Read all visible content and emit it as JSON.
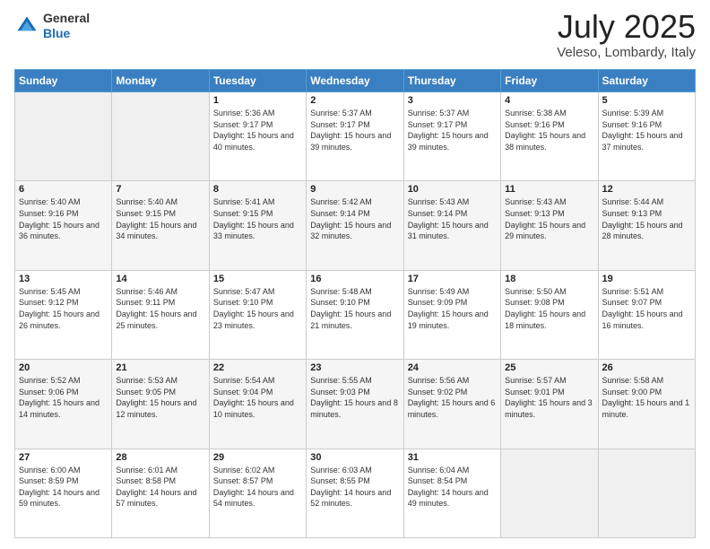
{
  "header": {
    "logo_general": "General",
    "logo_blue": "Blue",
    "month_title": "July 2025",
    "location": "Veleso, Lombardy, Italy"
  },
  "weekdays": [
    "Sunday",
    "Monday",
    "Tuesday",
    "Wednesday",
    "Thursday",
    "Friday",
    "Saturday"
  ],
  "weeks": [
    [
      {
        "day": "",
        "sunrise": "",
        "sunset": "",
        "daylight": ""
      },
      {
        "day": "",
        "sunrise": "",
        "sunset": "",
        "daylight": ""
      },
      {
        "day": "1",
        "sunrise": "Sunrise: 5:36 AM",
        "sunset": "Sunset: 9:17 PM",
        "daylight": "Daylight: 15 hours and 40 minutes."
      },
      {
        "day": "2",
        "sunrise": "Sunrise: 5:37 AM",
        "sunset": "Sunset: 9:17 PM",
        "daylight": "Daylight: 15 hours and 39 minutes."
      },
      {
        "day": "3",
        "sunrise": "Sunrise: 5:37 AM",
        "sunset": "Sunset: 9:17 PM",
        "daylight": "Daylight: 15 hours and 39 minutes."
      },
      {
        "day": "4",
        "sunrise": "Sunrise: 5:38 AM",
        "sunset": "Sunset: 9:16 PM",
        "daylight": "Daylight: 15 hours and 38 minutes."
      },
      {
        "day": "5",
        "sunrise": "Sunrise: 5:39 AM",
        "sunset": "Sunset: 9:16 PM",
        "daylight": "Daylight: 15 hours and 37 minutes."
      }
    ],
    [
      {
        "day": "6",
        "sunrise": "Sunrise: 5:40 AM",
        "sunset": "Sunset: 9:16 PM",
        "daylight": "Daylight: 15 hours and 36 minutes."
      },
      {
        "day": "7",
        "sunrise": "Sunrise: 5:40 AM",
        "sunset": "Sunset: 9:15 PM",
        "daylight": "Daylight: 15 hours and 34 minutes."
      },
      {
        "day": "8",
        "sunrise": "Sunrise: 5:41 AM",
        "sunset": "Sunset: 9:15 PM",
        "daylight": "Daylight: 15 hours and 33 minutes."
      },
      {
        "day": "9",
        "sunrise": "Sunrise: 5:42 AM",
        "sunset": "Sunset: 9:14 PM",
        "daylight": "Daylight: 15 hours and 32 minutes."
      },
      {
        "day": "10",
        "sunrise": "Sunrise: 5:43 AM",
        "sunset": "Sunset: 9:14 PM",
        "daylight": "Daylight: 15 hours and 31 minutes."
      },
      {
        "day": "11",
        "sunrise": "Sunrise: 5:43 AM",
        "sunset": "Sunset: 9:13 PM",
        "daylight": "Daylight: 15 hours and 29 minutes."
      },
      {
        "day": "12",
        "sunrise": "Sunrise: 5:44 AM",
        "sunset": "Sunset: 9:13 PM",
        "daylight": "Daylight: 15 hours and 28 minutes."
      }
    ],
    [
      {
        "day": "13",
        "sunrise": "Sunrise: 5:45 AM",
        "sunset": "Sunset: 9:12 PM",
        "daylight": "Daylight: 15 hours and 26 minutes."
      },
      {
        "day": "14",
        "sunrise": "Sunrise: 5:46 AM",
        "sunset": "Sunset: 9:11 PM",
        "daylight": "Daylight: 15 hours and 25 minutes."
      },
      {
        "day": "15",
        "sunrise": "Sunrise: 5:47 AM",
        "sunset": "Sunset: 9:10 PM",
        "daylight": "Daylight: 15 hours and 23 minutes."
      },
      {
        "day": "16",
        "sunrise": "Sunrise: 5:48 AM",
        "sunset": "Sunset: 9:10 PM",
        "daylight": "Daylight: 15 hours and 21 minutes."
      },
      {
        "day": "17",
        "sunrise": "Sunrise: 5:49 AM",
        "sunset": "Sunset: 9:09 PM",
        "daylight": "Daylight: 15 hours and 19 minutes."
      },
      {
        "day": "18",
        "sunrise": "Sunrise: 5:50 AM",
        "sunset": "Sunset: 9:08 PM",
        "daylight": "Daylight: 15 hours and 18 minutes."
      },
      {
        "day": "19",
        "sunrise": "Sunrise: 5:51 AM",
        "sunset": "Sunset: 9:07 PM",
        "daylight": "Daylight: 15 hours and 16 minutes."
      }
    ],
    [
      {
        "day": "20",
        "sunrise": "Sunrise: 5:52 AM",
        "sunset": "Sunset: 9:06 PM",
        "daylight": "Daylight: 15 hours and 14 minutes."
      },
      {
        "day": "21",
        "sunrise": "Sunrise: 5:53 AM",
        "sunset": "Sunset: 9:05 PM",
        "daylight": "Daylight: 15 hours and 12 minutes."
      },
      {
        "day": "22",
        "sunrise": "Sunrise: 5:54 AM",
        "sunset": "Sunset: 9:04 PM",
        "daylight": "Daylight: 15 hours and 10 minutes."
      },
      {
        "day": "23",
        "sunrise": "Sunrise: 5:55 AM",
        "sunset": "Sunset: 9:03 PM",
        "daylight": "Daylight: 15 hours and 8 minutes."
      },
      {
        "day": "24",
        "sunrise": "Sunrise: 5:56 AM",
        "sunset": "Sunset: 9:02 PM",
        "daylight": "Daylight: 15 hours and 6 minutes."
      },
      {
        "day": "25",
        "sunrise": "Sunrise: 5:57 AM",
        "sunset": "Sunset: 9:01 PM",
        "daylight": "Daylight: 15 hours and 3 minutes."
      },
      {
        "day": "26",
        "sunrise": "Sunrise: 5:58 AM",
        "sunset": "Sunset: 9:00 PM",
        "daylight": "Daylight: 15 hours and 1 minute."
      }
    ],
    [
      {
        "day": "27",
        "sunrise": "Sunrise: 6:00 AM",
        "sunset": "Sunset: 8:59 PM",
        "daylight": "Daylight: 14 hours and 59 minutes."
      },
      {
        "day": "28",
        "sunrise": "Sunrise: 6:01 AM",
        "sunset": "Sunset: 8:58 PM",
        "daylight": "Daylight: 14 hours and 57 minutes."
      },
      {
        "day": "29",
        "sunrise": "Sunrise: 6:02 AM",
        "sunset": "Sunset: 8:57 PM",
        "daylight": "Daylight: 14 hours and 54 minutes."
      },
      {
        "day": "30",
        "sunrise": "Sunrise: 6:03 AM",
        "sunset": "Sunset: 8:55 PM",
        "daylight": "Daylight: 14 hours and 52 minutes."
      },
      {
        "day": "31",
        "sunrise": "Sunrise: 6:04 AM",
        "sunset": "Sunset: 8:54 PM",
        "daylight": "Daylight: 14 hours and 49 minutes."
      },
      {
        "day": "",
        "sunrise": "",
        "sunset": "",
        "daylight": ""
      },
      {
        "day": "",
        "sunrise": "",
        "sunset": "",
        "daylight": ""
      }
    ]
  ]
}
